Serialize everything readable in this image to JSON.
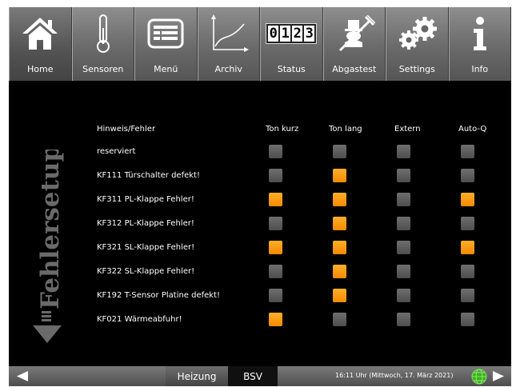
{
  "toolbar": {
    "items": [
      {
        "label": "Home",
        "icon": "home-icon"
      },
      {
        "label": "Sensoren",
        "icon": "thermometer-icon"
      },
      {
        "label": "Menü",
        "icon": "menu-list-icon"
      },
      {
        "label": "Archiv",
        "icon": "chart-curve-icon"
      },
      {
        "label": "Status",
        "icon": "counter-icon",
        "counter": [
          "0",
          "1",
          "2",
          "3"
        ]
      },
      {
        "label": "Abgastest",
        "icon": "chimney-sweep-icon"
      },
      {
        "label": "Settings",
        "icon": "gears-icon"
      },
      {
        "label": "Info",
        "icon": "info-icon"
      }
    ]
  },
  "page": {
    "title": "Fehlersetup"
  },
  "table": {
    "headers": [
      "Hinweis/Fehler",
      "Ton kurz",
      "Ton lang",
      "Extern",
      "Auto-Q"
    ],
    "rows": [
      {
        "label": "reserviert",
        "values": [
          false,
          false,
          false,
          false
        ]
      },
      {
        "label": "KF111 Türschalter defekt!",
        "values": [
          false,
          true,
          false,
          false
        ]
      },
      {
        "label": "KF311 PL-Klappe Fehler!",
        "values": [
          true,
          true,
          false,
          true
        ]
      },
      {
        "label": "KF312 PL-Klappe Fehler!",
        "values": [
          false,
          true,
          false,
          false
        ]
      },
      {
        "label": "KF321 SL-Klappe Fehler!",
        "values": [
          true,
          true,
          false,
          true
        ]
      },
      {
        "label": "KF322 SL-Klappe Fehler!",
        "values": [
          false,
          true,
          false,
          false
        ]
      },
      {
        "label": "KF192 T-Sensor Platine defekt!",
        "values": [
          false,
          true,
          false,
          false
        ]
      },
      {
        "label": "KF021 Wärmeabfuhr!",
        "values": [
          true,
          false,
          false,
          false
        ]
      }
    ]
  },
  "statusbar": {
    "tab_heizung": "Heizung",
    "tab_bsv": "BSV",
    "datetime": "16:11 Uhr (Mittwoch, 17. März 2021)"
  },
  "colors": {
    "checked": "#f89400",
    "unchecked": "#5a5a5a",
    "background": "#000000",
    "globe": "#3cb020"
  }
}
